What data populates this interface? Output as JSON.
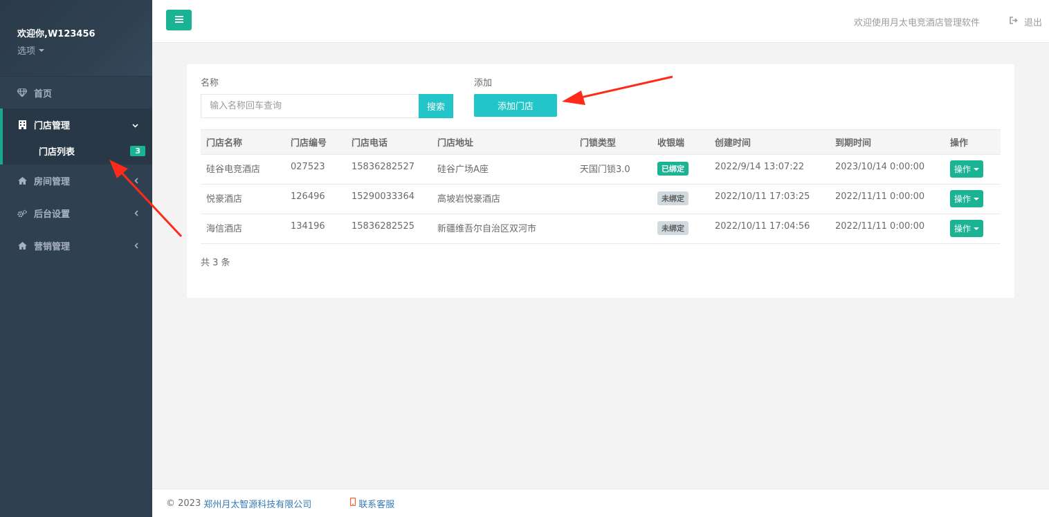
{
  "sidebar": {
    "welcome": "欢迎你,W123456",
    "options_label": "选项",
    "items": [
      {
        "label": "首页",
        "icon": "diamond-icon"
      },
      {
        "label": "门店管理",
        "icon": "building-icon",
        "sub": [
          {
            "label": "门店列表",
            "badge": "3"
          }
        ]
      },
      {
        "label": "房间管理",
        "icon": "home-icon"
      },
      {
        "label": "后台设置",
        "icon": "gears-icon"
      },
      {
        "label": "营销管理",
        "icon": "home-icon"
      }
    ]
  },
  "header": {
    "welcome_text": "欢迎使用月太电竞酒店管理软件",
    "logout_label": "退出"
  },
  "search": {
    "name_label": "名称",
    "placeholder": "输入名称回车查询",
    "search_button": "搜索",
    "add_label": "添加",
    "add_button": "添加门店"
  },
  "table": {
    "columns": [
      "门店名称",
      "门店编号",
      "门店电话",
      "门店地址",
      "门锁类型",
      "收银端",
      "创建时间",
      "到期时间",
      "操作"
    ],
    "rows": [
      {
        "name": "硅谷电竞酒店",
        "code": "027523",
        "phone": "15836282527",
        "address": "硅谷广场A座",
        "lock": "天国门锁3.0",
        "pos": "已绑定",
        "pos_bound": true,
        "created": "2022/9/14 13:07:22",
        "expires": "2023/10/14 0:00:00",
        "action": "操作"
      },
      {
        "name": "悦豪酒店",
        "code": "126496",
        "phone": "15290033364",
        "address": "高坡岩悦豪酒店",
        "lock": "",
        "pos": "未绑定",
        "pos_bound": false,
        "created": "2022/10/11 17:03:25",
        "expires": "2022/11/11 0:00:00",
        "action": "操作"
      },
      {
        "name": "海信酒店",
        "code": "134196",
        "phone": "15836282525",
        "address": "新疆维吾尔自治区双河市",
        "lock": "",
        "pos": "未绑定",
        "pos_bound": false,
        "created": "2022/10/11 17:04:56",
        "expires": "2022/11/11 0:00:00",
        "action": "操作"
      }
    ],
    "total_text": "共 3 条"
  },
  "footer": {
    "copyright": "© 2023",
    "company": "郑州月太智源科技有限公司",
    "service": "联系客服"
  },
  "colors": {
    "sidebar_bg": "#2f4050",
    "primary": "#1ab394",
    "info": "#23c6c8",
    "arrow": "#ff2a1a"
  }
}
